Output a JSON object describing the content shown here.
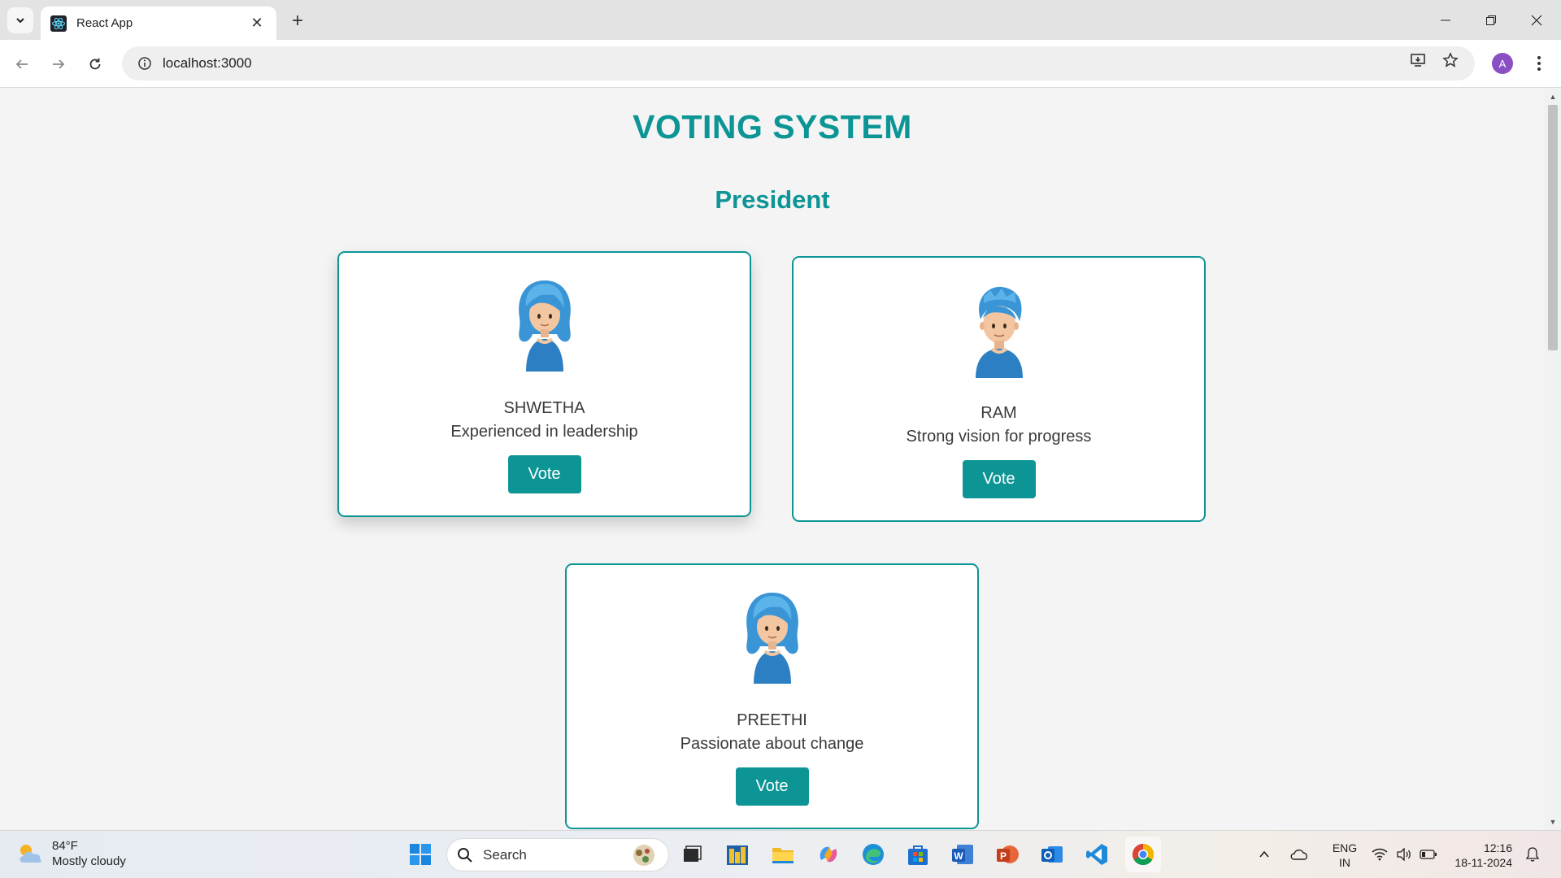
{
  "browser": {
    "tab_title": "React App",
    "url": "localhost:3000",
    "profile_initial": "A"
  },
  "page": {
    "title": "VOTING SYSTEM",
    "section": "President",
    "candidates": [
      {
        "name": "SHWETHA",
        "description": "Experienced in leadership",
        "vote_label": "Vote",
        "avatar_icon": "woman-blue-hair-emoji"
      },
      {
        "name": "RAM",
        "description": "Strong vision for progress",
        "vote_label": "Vote",
        "avatar_icon": "man-blue-hair-emoji"
      },
      {
        "name": "PREETHI",
        "description": "Passionate about change",
        "vote_label": "Vote",
        "avatar_icon": "woman-blue-hair-emoji"
      }
    ]
  },
  "taskbar": {
    "weather_temp": "84°F",
    "weather_desc": "Mostly cloudy",
    "search_label": "Search",
    "lang_primary": "ENG",
    "lang_secondary": "IN",
    "time": "12:16",
    "date": "18-11-2024"
  },
  "colors": {
    "accent": "#0d9596",
    "card_border": "#0d9596",
    "page_bg": "#f4f4f4"
  }
}
